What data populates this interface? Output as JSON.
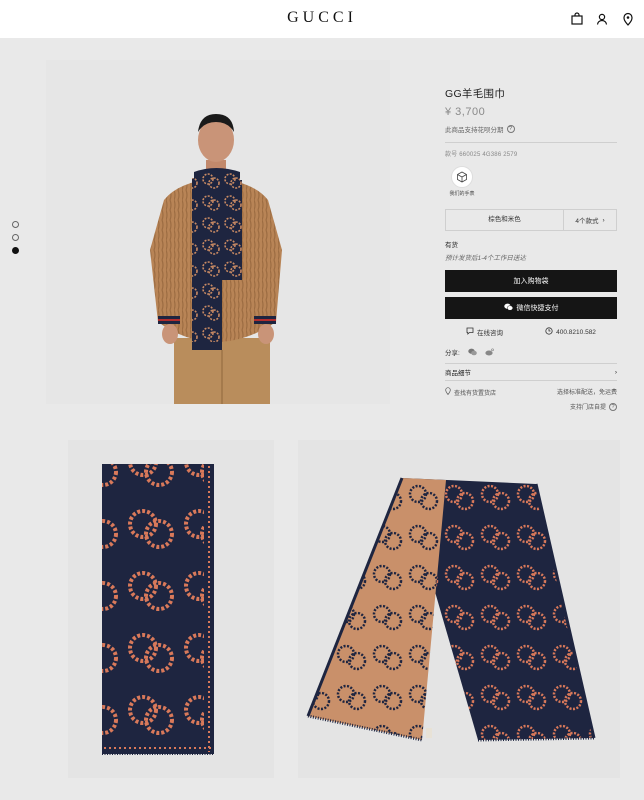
{
  "header": {
    "logo": "GUCCI",
    "icons": [
      "shopping-bag-icon",
      "user-icon",
      "location-pin-icon"
    ]
  },
  "carousel": {
    "count": 3,
    "active_index": 2
  },
  "product": {
    "title": "GG羊毛围巾",
    "price": "¥ 3,700",
    "installment": "此商品支持花呗分期",
    "sku": "款号 660025 4G386 2579",
    "ar_label": "我们的手表",
    "variant_color": "棕色和米色",
    "variant_count": "4个款式",
    "stock": "有货",
    "shipping": "预计发货后1-4个工作日送达",
    "add_to_bag": "加入购物袋",
    "wechat_pay": "微信快捷支付",
    "online_consult": "在线咨询",
    "phone": "400.8210.582",
    "share_label": "分享:",
    "details_label": "商品细节",
    "store_search": "查找有货置货店",
    "delivery_option": "选择标准配送，免运费",
    "store_pickup": "支持门店自提"
  },
  "colors": {
    "navy": "#1e2540",
    "camel": "#b78655",
    "coral": "#d9795a",
    "black_button": "#151515"
  }
}
